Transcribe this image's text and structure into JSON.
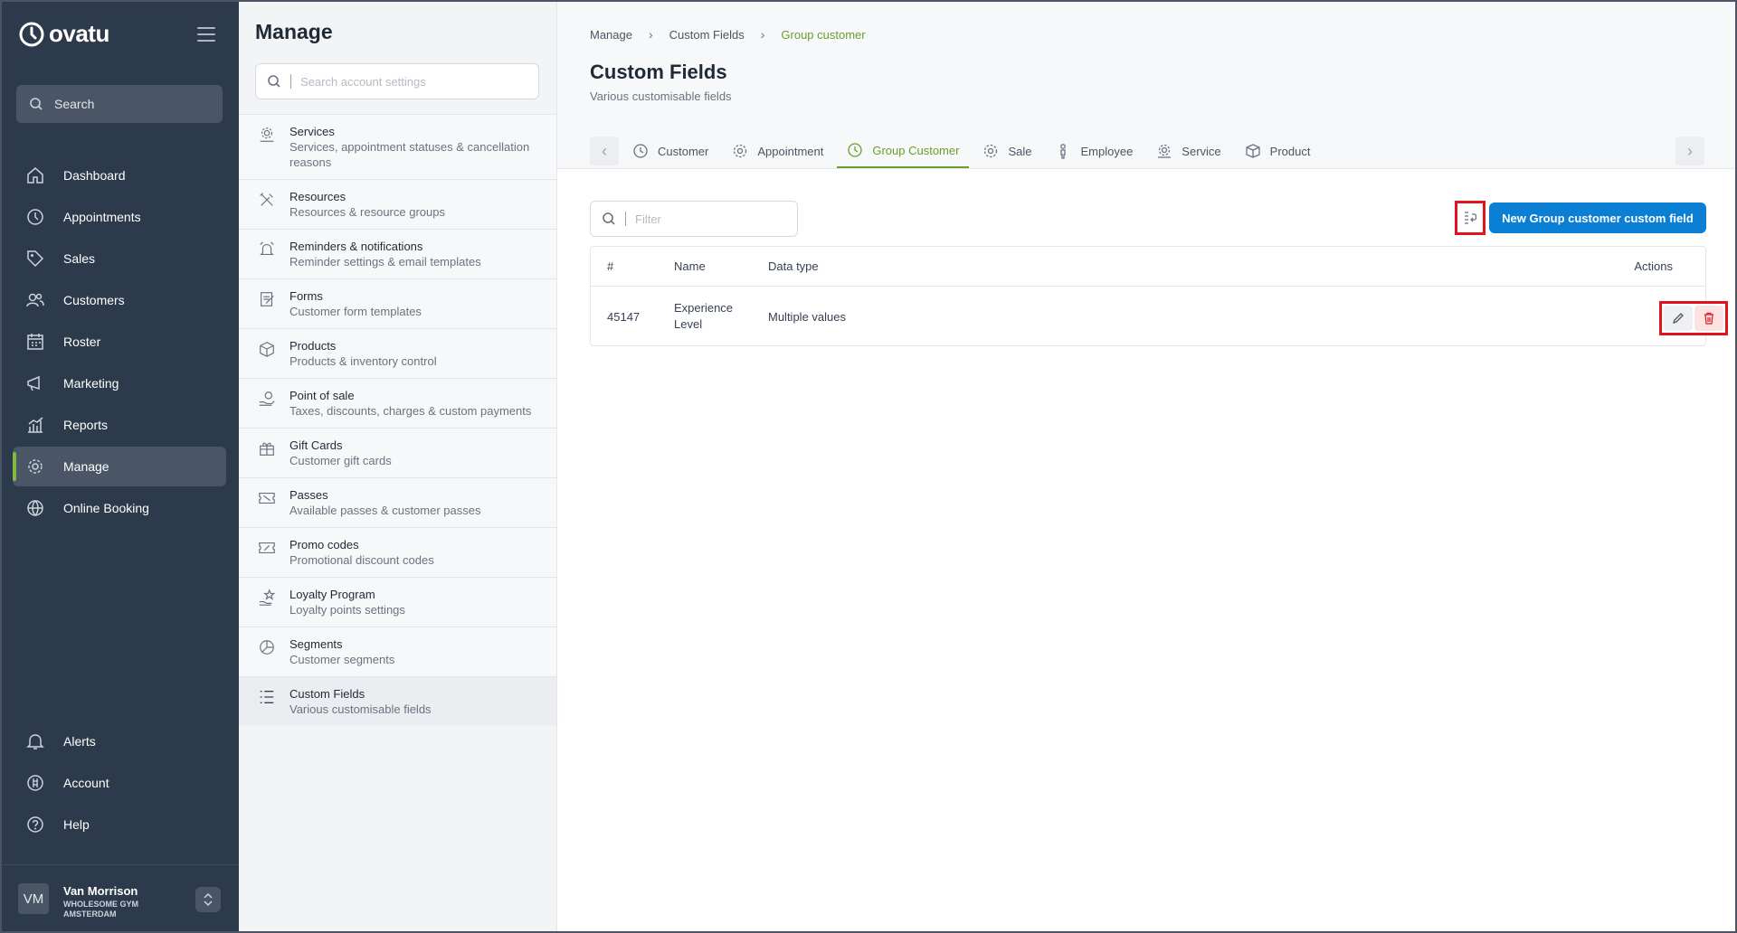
{
  "brand": {
    "name": "ovatu",
    "accent": "#7dbd3b",
    "nav_bg": "#2d3a4b",
    "primary_button": "#0b7fd3",
    "highlight": "#e0141e"
  },
  "nav": {
    "search_label": "Search",
    "items": [
      {
        "label": "Dashboard",
        "icon": "home-icon"
      },
      {
        "label": "Appointments",
        "icon": "clock-icon"
      },
      {
        "label": "Sales",
        "icon": "tag-icon"
      },
      {
        "label": "Customers",
        "icon": "users-icon"
      },
      {
        "label": "Roster",
        "icon": "calendar-icon"
      },
      {
        "label": "Marketing",
        "icon": "megaphone-icon"
      },
      {
        "label": "Reports",
        "icon": "chart-icon"
      },
      {
        "label": "Manage",
        "icon": "gear-icon",
        "active": true
      },
      {
        "label": "Online Booking",
        "icon": "globe-icon"
      }
    ],
    "bottom_items": [
      {
        "label": "Alerts",
        "icon": "bell-icon"
      },
      {
        "label": "Account",
        "icon": "account-icon"
      },
      {
        "label": "Help",
        "icon": "help-icon"
      }
    ],
    "user": {
      "initials": "VM",
      "name": "Van Morrison",
      "org": "WHOLESOME GYM AMSTERDAM"
    }
  },
  "manage": {
    "title": "Manage",
    "search_placeholder": "Search account settings",
    "items": [
      {
        "title": "Services",
        "sub": "Services, appointment statuses & cancellation reasons"
      },
      {
        "title": "Resources",
        "sub": "Resources & resource groups"
      },
      {
        "title": "Reminders & notifications",
        "sub": "Reminder settings & email templates"
      },
      {
        "title": "Forms",
        "sub": "Customer form templates"
      },
      {
        "title": "Products",
        "sub": "Products & inventory control"
      },
      {
        "title": "Point of sale",
        "sub": "Taxes, discounts, charges & custom payments"
      },
      {
        "title": "Gift Cards",
        "sub": "Customer gift cards"
      },
      {
        "title": "Passes",
        "sub": "Available passes & customer passes"
      },
      {
        "title": "Promo codes",
        "sub": "Promotional discount codes"
      },
      {
        "title": "Loyalty Program",
        "sub": "Loyalty points settings"
      },
      {
        "title": "Segments",
        "sub": "Customer segments"
      },
      {
        "title": "Custom Fields",
        "sub": "Various customisable fields",
        "active": true
      }
    ]
  },
  "breadcrumb": [
    "Manage",
    "Custom Fields",
    "Group customer"
  ],
  "page": {
    "title": "Custom Fields",
    "subtitle": "Various customisable fields"
  },
  "tabs": [
    {
      "label": "Customer",
      "icon": "clock-icon"
    },
    {
      "label": "Appointment",
      "icon": "gear-icon"
    },
    {
      "label": "Group Customer",
      "icon": "clock-icon",
      "active": true
    },
    {
      "label": "Sale",
      "icon": "gear-icon"
    },
    {
      "label": "Employee",
      "icon": "person-icon"
    },
    {
      "label": "Service",
      "icon": "gear-icon"
    },
    {
      "label": "Product",
      "icon": "box-icon"
    }
  ],
  "toolbar": {
    "filter_placeholder": "Filter",
    "new_button": "New Group customer custom field"
  },
  "table": {
    "headers": {
      "id": "#",
      "name": "Name",
      "type": "Data type",
      "actions": "Actions"
    },
    "rows": [
      {
        "id": "45147",
        "name": "Experience Level",
        "type": "Multiple values"
      }
    ]
  }
}
